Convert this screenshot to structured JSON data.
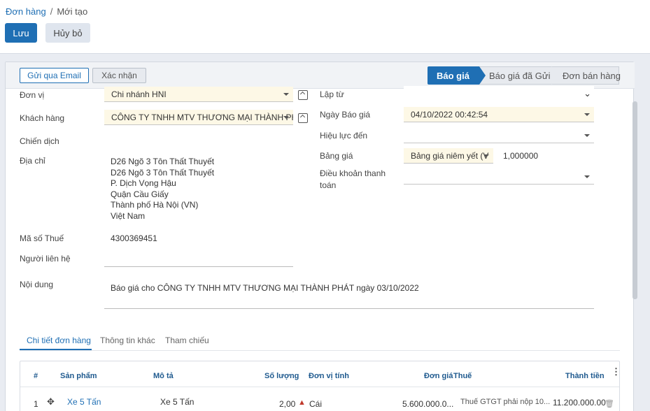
{
  "breadcrumb": {
    "parent": "Đơn hàng",
    "separator": "/",
    "current": "Mới tạo"
  },
  "toolbar": {
    "save_label": "Lưu",
    "cancel_label": "Hủy bỏ"
  },
  "actions": {
    "email_label": "Gửi qua Email",
    "confirm_label": "Xác nhận"
  },
  "status_bar": {
    "steps": [
      "Báo giá",
      "Báo giá đã Gửi",
      "Đơn bán hàng"
    ],
    "active": "Báo giá"
  },
  "form_left": {
    "unit_label": "Đơn vị",
    "unit_value": "Chi nhánh HNI",
    "customer_label": "Khách hàng",
    "customer_value": "CÔNG TY TNHH MTV THƯƠNG MẠI THÀNH PHÁ",
    "campaign_label": "Chiến dịch",
    "address_label": "Địa chỉ",
    "address_lines": [
      "D26 Ngõ 3 Tôn Thất Thuyết",
      "D26 Ngõ 3 Tôn Thất Thuyết",
      "P. Dịch Vọng Hậu",
      "Quận Cầu Giấy",
      "Thành phố Hà Nội (VN)",
      "Việt Nam"
    ],
    "tax_label": "Mã số Thuế",
    "tax_value": "4300369451",
    "contact_label": "Người liên hệ",
    "content_label": "Nội dung",
    "content_value": "Báo giá cho CÔNG TY TNHH MTV THƯƠNG MẠI THÀNH PHÁT ngày 03/10/2022"
  },
  "form_right": {
    "from_label": "Lập từ",
    "quote_date_label": "Ngày Báo giá",
    "quote_date_value": "04/10/2022 00:42:54",
    "valid_until_label": "Hiệu lực đến",
    "pricelist_label": "Bảng giá",
    "pricelist_value": "Bảng giá niêm yết (V",
    "rate_value": "1,000000",
    "payment_terms_label_1": "Điều khoản thanh",
    "payment_terms_label_2": "toán"
  },
  "tabs": [
    "Chi tiết đơn hàng",
    "Thông tin khác",
    "Tham chiếu"
  ],
  "table": {
    "headers": [
      "#",
      "Sản phẩm",
      "Mô tả",
      "Số lượng",
      "Đơn vị tính",
      "Đơn giá",
      "Thuế",
      "Thành tiền"
    ],
    "rows": [
      {
        "no": "1",
        "product": "Xe 5 Tấn",
        "description": "Xe 5 Tấn",
        "qty": "2,00",
        "uom": "Cái",
        "price": "5.600.000.0...",
        "tax": "Thuế GTGT phải nộp 10...",
        "total": "11.200.000.00"
      }
    ]
  },
  "colors": {
    "primary": "#1f6fb4",
    "required_bg": "#fdf8e6"
  }
}
